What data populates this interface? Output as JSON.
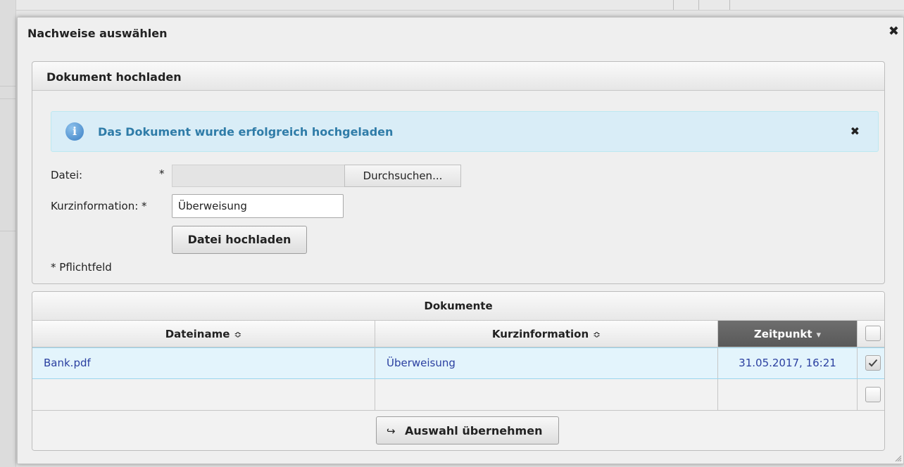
{
  "dialog": {
    "title": "Nachweise auswählen",
    "close_glyph": "✖"
  },
  "upload_panel": {
    "title": "Dokument hochladen",
    "alert": {
      "icon": "info-icon",
      "icon_glyph": "i",
      "message": "Das Dokument wurde erfolgreich hochgeladen",
      "close_glyph": "✖"
    },
    "file_label": "Datei:",
    "file_required": "*",
    "file_value": "",
    "browse_label": "Durchsuchen...",
    "short_info_label": "Kurzinformation: *",
    "short_info_value": "Überweisung",
    "upload_button": "Datei hochladen",
    "required_note": "* Pflichtfeld"
  },
  "documents": {
    "caption": "Dokumente",
    "columns": [
      {
        "label": "Dateiname",
        "sort_glyph": "≎",
        "sorted": false
      },
      {
        "label": "Kurzinformation",
        "sort_glyph": "≎",
        "sorted": false
      },
      {
        "label": "Zeitpunkt",
        "sort_glyph": "▾",
        "sorted": true
      }
    ],
    "header_checkbox_checked": false,
    "rows": [
      {
        "filename": "Bank.pdf",
        "short_info": "Überweisung",
        "timestamp": "31.05.2017, 16:21",
        "checked": true
      },
      {
        "filename": "",
        "short_info": "",
        "timestamp": "",
        "checked": false
      }
    ],
    "apply_button": "Auswahl übernehmen",
    "apply_icon_glyph": "↪"
  },
  "colors": {
    "alert_bg": "#d9edf7",
    "alert_text": "#2f7ca8",
    "link_text": "#2a3fa0",
    "active_header_bg": "#5f5f5f",
    "selected_row_bg": "#e3f4fc"
  }
}
